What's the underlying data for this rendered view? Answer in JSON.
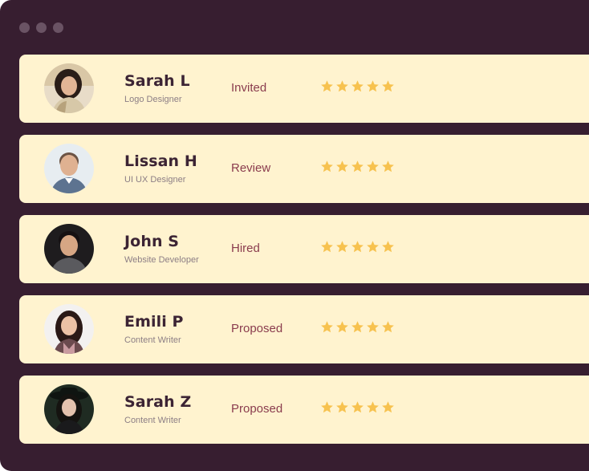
{
  "colors": {
    "window_bg": "#371e30",
    "card_bg": "#fff3cf",
    "name_color": "#3c2434",
    "status_color": "#8a3c4e",
    "star_color": "#f7c24f"
  },
  "candidates": [
    {
      "name": "Sarah L",
      "role": "Logo Designer",
      "status": "Invited",
      "rating": 5,
      "avatar_icon": "avatar-photo-woman-icon"
    },
    {
      "name": "Lissan H",
      "role": "UI UX Designer",
      "status": "Review",
      "rating": 5,
      "avatar_icon": "avatar-photo-man-icon"
    },
    {
      "name": "John S",
      "role": "Website Developer",
      "status": "Hired",
      "rating": 5,
      "avatar_icon": "avatar-photo-man-icon"
    },
    {
      "name": "Emili P",
      "role": "Content Writer",
      "status": "Proposed",
      "rating": 5,
      "avatar_icon": "avatar-photo-woman-icon"
    },
    {
      "name": "Sarah Z",
      "role": "Content Writer",
      "status": "Proposed",
      "rating": 5,
      "avatar_icon": "avatar-photo-woman-icon"
    }
  ]
}
